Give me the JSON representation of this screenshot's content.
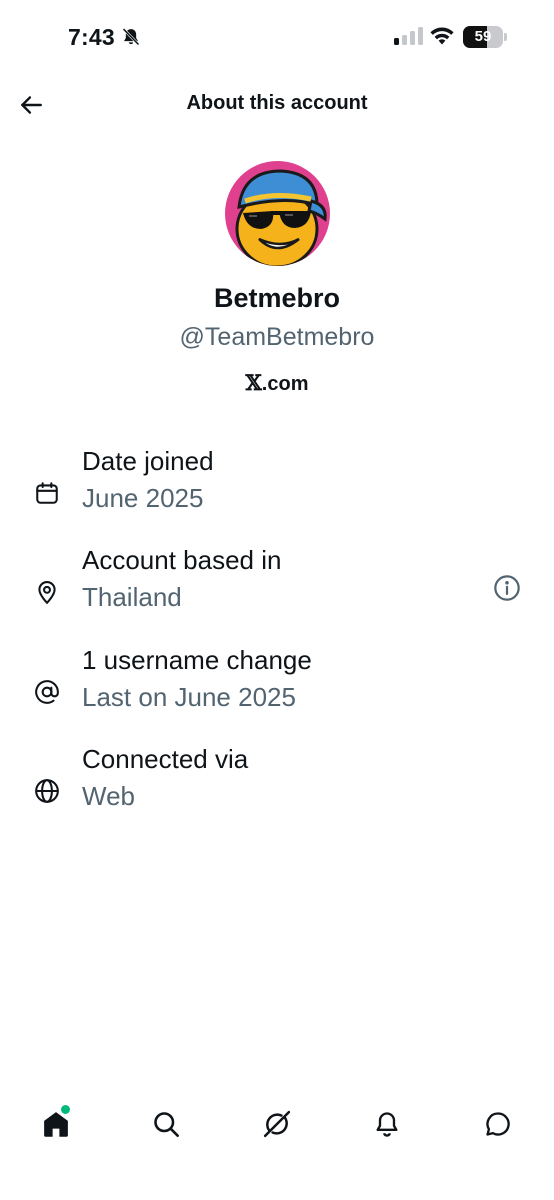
{
  "status_bar": {
    "time": "7:43",
    "battery_percent": "59",
    "battery_level": 0.59,
    "signal_bars_on": 1,
    "signal_bars_total": 4
  },
  "header": {
    "title": "About this account"
  },
  "profile": {
    "display_name": "Betmebro",
    "handle": "@TeamBetmebro",
    "site": ".com",
    "site_logo": "x-logo"
  },
  "rows": [
    {
      "icon": "calendar-icon",
      "label": "Date joined",
      "value": "June 2025"
    },
    {
      "icon": "location-pin-icon",
      "label": "Account based in",
      "value": "Thailand",
      "has_info": true
    },
    {
      "icon": "at-sign-icon",
      "label": "1 username change",
      "value": "Last on June 2025"
    },
    {
      "icon": "globe-icon",
      "label": "Connected via",
      "value": "Web"
    }
  ],
  "bottom_nav": {
    "items": [
      "home-icon",
      "search-icon",
      "grok-icon",
      "notifications-icon",
      "messages-icon"
    ],
    "active": "home-icon",
    "notification_dot_color": "#00ba7c"
  },
  "colors": {
    "text_primary": "#0f1419",
    "text_secondary": "#536471",
    "avatar_bg": "#e0418f"
  }
}
